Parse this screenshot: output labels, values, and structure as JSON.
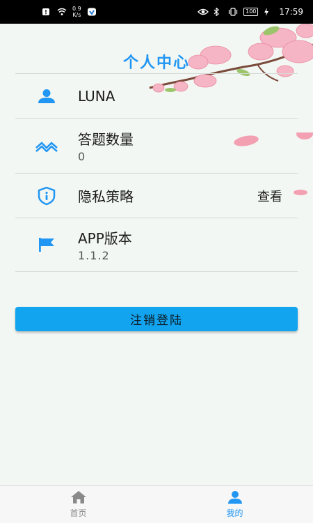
{
  "status_bar": {
    "speed_value": "0.9",
    "speed_unit": "K/s",
    "battery": "100",
    "time": "17:59"
  },
  "page_title": "个人中心",
  "profile": {
    "username": "LUNA"
  },
  "stats": {
    "answer_count_label": "答题数量",
    "answer_count_value": "0"
  },
  "privacy": {
    "label": "隐私策略",
    "action": "查看"
  },
  "version": {
    "label": "APP版本",
    "value": "1.1.2"
  },
  "logout_label": "注销登陆",
  "bottom_nav": {
    "home_label": "首页",
    "mine_label": "我的"
  },
  "colors": {
    "accent": "#2196f3",
    "button": "#12a4ef",
    "inactive": "#8a8a8a"
  }
}
